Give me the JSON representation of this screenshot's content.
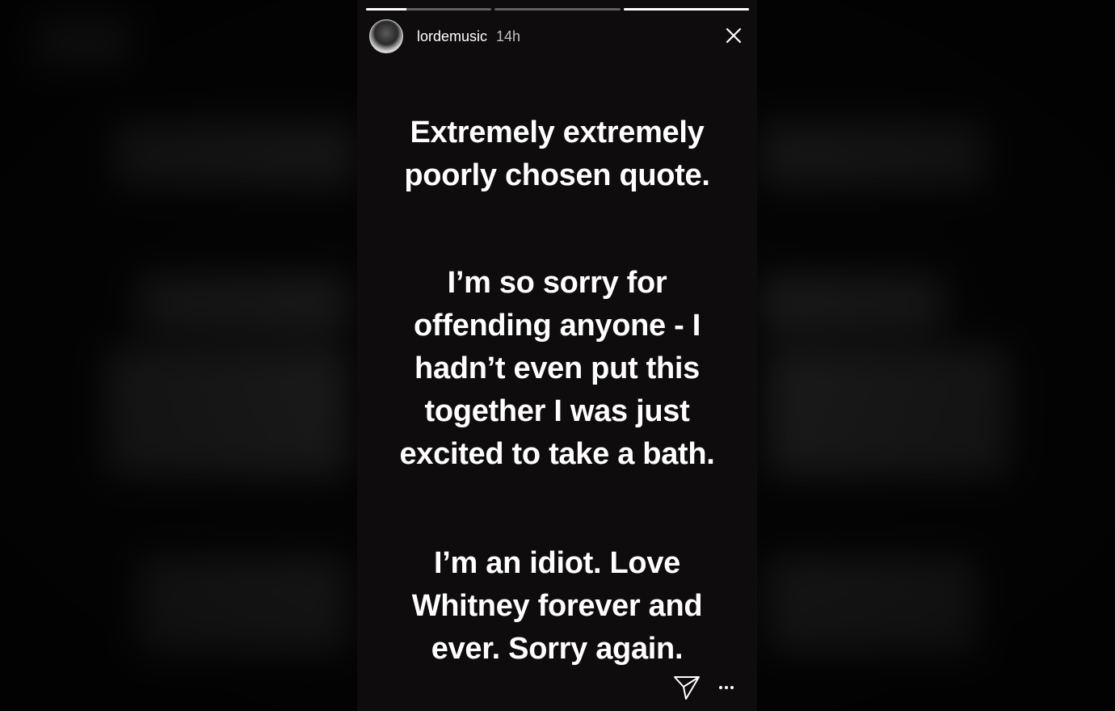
{
  "story": {
    "username": "lordemusic",
    "time_ago": "14h",
    "progress": [
      0.32,
      0,
      1
    ],
    "paragraphs": [
      [
        "Extremely extremely",
        "poorly chosen quote."
      ],
      [
        "I’m so sorry for",
        "offending anyone - I",
        "hadn’t even put this",
        "together I was just",
        "excited to take a bath."
      ],
      [
        "I’m an idiot. Love",
        "Whitney forever and",
        "ever. Sorry again."
      ]
    ]
  },
  "icons": {
    "close": "close-icon",
    "send": "send-paper-plane-icon",
    "more": "more-dots-icon"
  },
  "colors": {
    "background": "#0e0c0d",
    "text": "#ffffff"
  }
}
